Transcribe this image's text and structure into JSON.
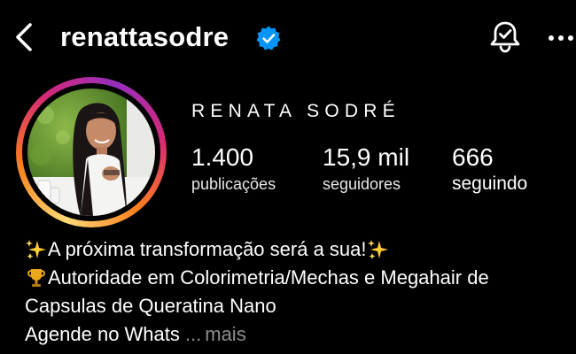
{
  "header": {
    "username": "renattasodre",
    "icons": [
      "back-arrow-icon",
      "verified-badge-icon",
      "notification-bell-icon",
      "more-options-icon"
    ]
  },
  "profile": {
    "display_name": "RENATA SODRÉ",
    "stats": [
      {
        "value": "1.400",
        "label": "publicações"
      },
      {
        "value": "15,9 mil",
        "label": "seguidores"
      },
      {
        "value": "666",
        "label": "seguindo"
      }
    ]
  },
  "bio": {
    "line1": "A próxima transformação será a sua!",
    "line2": "Autoridade em Colorimetria/Mechas e Megahair de",
    "line3": "Capsulas de Queratina Nano",
    "line4": "Agende no Whats",
    "ellipsis": "...",
    "more_label": "mais"
  },
  "colors": {
    "background": "#000000",
    "text": "#ffffff",
    "muted": "#8e8e8e",
    "verified_blue": "#0095f6",
    "story_ring": [
      "#feda75",
      "#fa7e1e",
      "#d62976",
      "#962fbf"
    ]
  }
}
